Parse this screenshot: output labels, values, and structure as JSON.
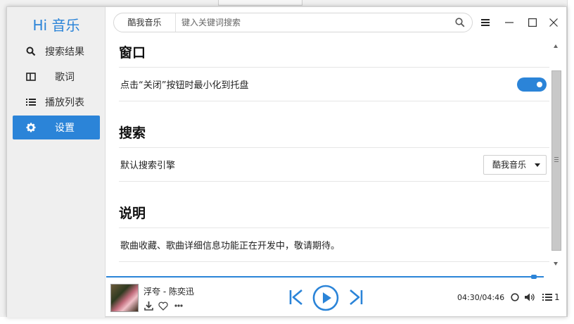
{
  "app": {
    "name": "Hi 音乐"
  },
  "sidebar": {
    "items": [
      {
        "label": "搜索结果",
        "icon": "search-icon",
        "active": false
      },
      {
        "label": "歌词",
        "icon": "lyrics-panel-icon",
        "active": false
      },
      {
        "label": "播放列表",
        "icon": "list-icon",
        "active": false
      },
      {
        "label": "设置",
        "icon": "gear-icon",
        "active": true
      }
    ]
  },
  "search": {
    "engine": "酷我音乐",
    "placeholder": "键入关键词搜索",
    "value": ""
  },
  "settings": {
    "window": {
      "title": "窗口",
      "minimize_to_tray_label": "点击“关闭”按钮时最小化到托盘",
      "minimize_to_tray_enabled": true
    },
    "search": {
      "title": "搜索",
      "default_engine_label": "默认搜索引擎",
      "default_engine_value": "酷我音乐"
    },
    "about": {
      "title": "说明",
      "text": "歌曲收藏、歌曲详细信息功能正在开发中，敬请期待。"
    }
  },
  "player": {
    "song": "浮夸 - 陈奕迅",
    "time": "04:30/04:46",
    "progress": 0.978,
    "playlist_count": "1"
  },
  "colors": {
    "accent": "#2b84d8",
    "sidebar_bg": "#efefef",
    "text": "#222222"
  }
}
